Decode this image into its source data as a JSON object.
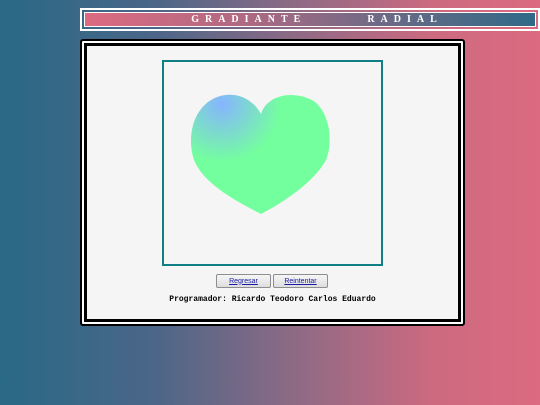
{
  "header": {
    "title": "GRADIANTE  RADIAL"
  },
  "canvas": {
    "shape": "heart",
    "gradient_type": "radial",
    "gradient_colors": {
      "center": "#86b4ff",
      "outer": "#74ff9e"
    },
    "border_color": "#0f7f85"
  },
  "buttons": {
    "back_label": "Regresar",
    "retry_label": "Reintentar"
  },
  "footer": {
    "programmer": "Programador: Ricardo Teodoro Carlos Eduardo"
  },
  "colors": {
    "background_left": "#296985",
    "background_right": "#dc6a80"
  }
}
